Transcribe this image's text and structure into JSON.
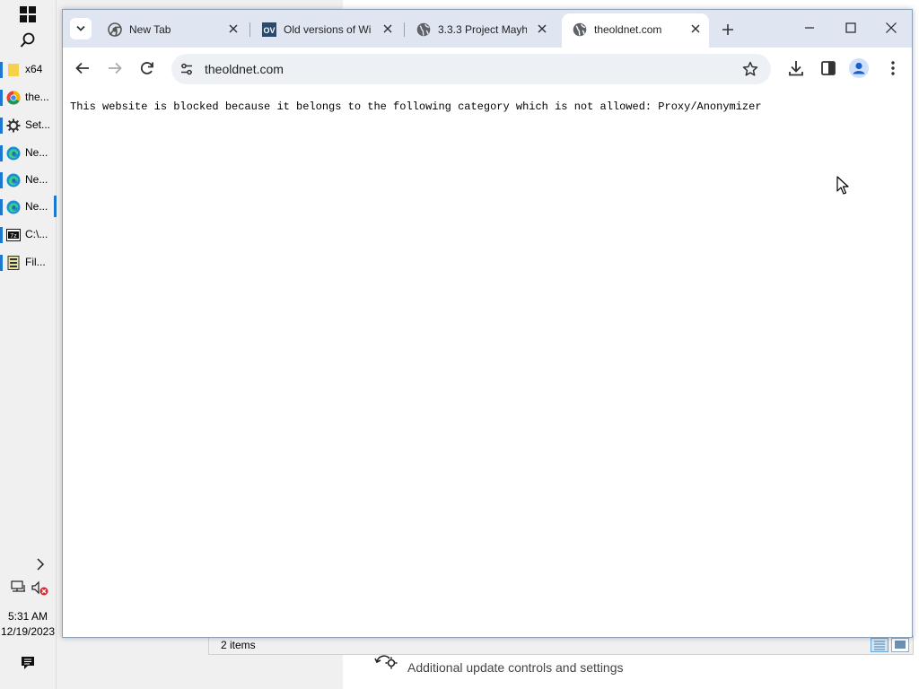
{
  "taskbar": {
    "items": [
      {
        "label": "x64",
        "icon": "folder-icon"
      },
      {
        "label": "the...",
        "icon": "chrome-icon"
      },
      {
        "label": "Set...",
        "icon": "gear-icon"
      },
      {
        "label": "Ne...",
        "icon": "edge-icon"
      },
      {
        "label": "Ne...",
        "icon": "edge-icon"
      },
      {
        "label": "Ne...",
        "icon": "edge-icon"
      },
      {
        "label": "C:\\...",
        "icon": "7zip-icon"
      },
      {
        "label": "Fil...",
        "icon": "file-manager-icon"
      }
    ],
    "time": "5:31 AM",
    "date": "12/19/2023"
  },
  "browser": {
    "tabs": [
      {
        "title": "New Tab",
        "icon": "chrome-icon",
        "active": false
      },
      {
        "title": "Old versions of Wi",
        "icon": "ov-icon",
        "active": false
      },
      {
        "title": "3.3.3 Project Mayh",
        "icon": "globe-icon",
        "active": false
      },
      {
        "title": "theoldnet.com",
        "icon": "globe-icon",
        "active": true
      }
    ],
    "address": "theoldnet.com",
    "page_message": "This website is blocked because it belongs to the following category which is not allowed: Proxy/Anonymizer",
    "accent": "#1e78d2"
  },
  "background": {
    "explorer_status": "2 items",
    "update_text": "Additional update controls and settings"
  }
}
